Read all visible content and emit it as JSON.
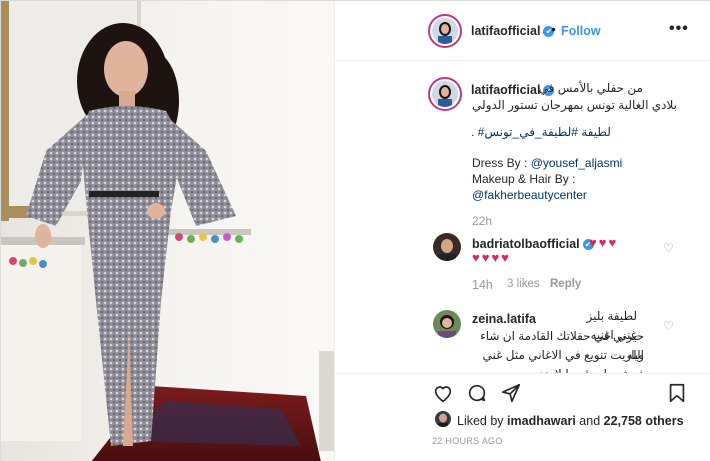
{
  "post": {
    "username": "latifaofficial",
    "verified_mark": "✔",
    "dot_separator": "•",
    "follow_label": "Follow",
    "more_icon": "•••"
  },
  "caption": {
    "username": "latifaofficial",
    "line1": "من حفلي بالأمس في",
    "line2": "بلادي الغالية تونس بمهرجان تستور الدولي",
    "hashtags": "لطيفة #لطيفة_في_تونس# .",
    "dress_prefix": "Dress By : ",
    "dress_mention": "@yousef_aljasmi",
    "makeup": "Makeup & Hair By :",
    "makeup_mention": "@fakherbeautycenter",
    "time": "22h"
  },
  "comments": [
    {
      "username": "badriatolbaofficial",
      "hearts_line1": "♥♥♥",
      "hearts_line2": "♥♥♥♥",
      "time": "14h",
      "likes": "3 likes",
      "reply_label": "Reply"
    },
    {
      "username": "zeina.latifa",
      "line0": "لطيفة بليز غني اغنيه",
      "line1": "حيرني في حفلاتك القادمة ان شاء الله",
      "line2": "وياريت تنويع في الاغاني مثل غني",
      "line3": "فرش ماجوقه وايلا هدوم من"
    }
  ],
  "actions": {
    "like_icon": "heart-outline-icon",
    "comment_icon": "comment-bubble-icon",
    "share_icon": "paper-plane-icon",
    "save_icon": "bookmark-icon",
    "liked_by_prefix": "Liked by ",
    "liked_by_user": "imadhawari",
    "liked_by_middle": " and ",
    "liked_by_count": "22,758 others",
    "timestamp": "22 HOURS AGO"
  },
  "nav": {
    "next_icon": "›"
  },
  "colors": {
    "accent": "#3897f0",
    "link": "#003569",
    "heart": "#e0245e",
    "muted": "#999999"
  }
}
